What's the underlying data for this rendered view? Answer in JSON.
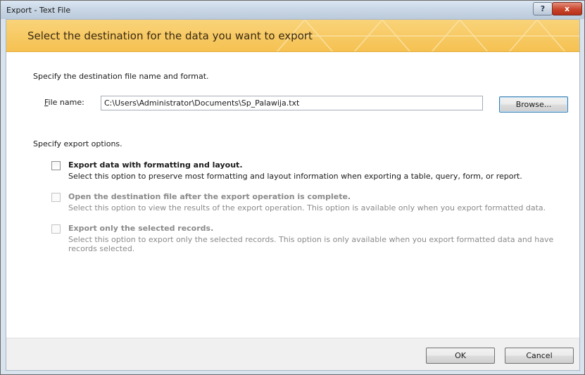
{
  "window": {
    "title": "Export - Text File",
    "help_label": "?",
    "close_label": "x"
  },
  "banner": {
    "title": "Select the destination for the data you want to export"
  },
  "destination": {
    "heading": "Specify the destination file name and format.",
    "file_label": "File name:",
    "file_value": "C:\\Users\\Administrator\\Documents\\Sp_Palawija.txt",
    "browse_label": "Browse..."
  },
  "options": {
    "heading": "Specify export options.",
    "items": [
      {
        "title": "Export data with formatting and layout.",
        "description": "Select this option to preserve most formatting and layout information when exporting a table, query, form, or report.",
        "checked": false,
        "enabled": true
      },
      {
        "title": "Open the destination file after the export operation is complete.",
        "description": "Select this option to view the results of the export operation. This option is available only when you export formatted data.",
        "checked": false,
        "enabled": false
      },
      {
        "title": "Export only the selected records.",
        "description": "Select this option to export only the selected records. This option is only available when you export formatted data and have records selected.",
        "checked": false,
        "enabled": false
      }
    ]
  },
  "footer": {
    "ok_label": "OK",
    "cancel_label": "Cancel"
  },
  "colors": {
    "banner": "#f5c151",
    "close_button": "#c9442b",
    "default_button_border": "#3c7fb1"
  }
}
